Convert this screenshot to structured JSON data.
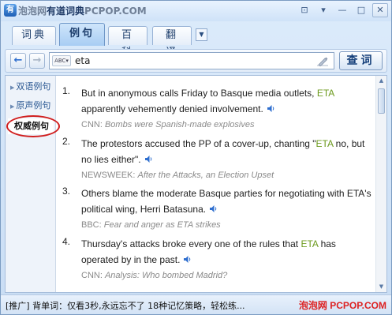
{
  "window": {
    "title": "有道词典",
    "watermark_prefix": "泡泡网",
    "watermark_suffix": "PCPOP.COM",
    "controls": [
      "⊡",
      "▾",
      "—",
      "□",
      "✕"
    ]
  },
  "tabs": [
    {
      "label": "词典",
      "active": false
    },
    {
      "label": "例句",
      "active": true
    },
    {
      "label": "百科",
      "active": false
    },
    {
      "label": "翻译",
      "active": false
    }
  ],
  "toolbar": {
    "search_value": "eta",
    "abc_label": "ABC",
    "query_label": "查词"
  },
  "sidebar": {
    "items": [
      {
        "label": "双语例句"
      },
      {
        "label": "原声例句"
      },
      {
        "label": "权威例句",
        "active": true
      }
    ]
  },
  "results": [
    {
      "num": "1.",
      "text_before": "But in anonymous calls Friday to Basque media outlets, ",
      "highlight": "ETA",
      "text_after": " apparently vehemently denied involvement.",
      "source": "CNN: ",
      "source_title": "Bombs were Spanish-made explosives"
    },
    {
      "num": "2.",
      "text_before": "The protestors accused the PP of a cover-up, chanting \"",
      "highlight": "ETA",
      "text_after": " no, but no lies either\".",
      "source": "NEWSWEEK: ",
      "source_title": "After the Attacks, an Election Upset"
    },
    {
      "num": "3.",
      "text_before": "Others blame the moderate Basque parties for negotiating with ETA's political wing, Herri Batasuna.",
      "highlight": "",
      "text_after": "",
      "source": "BBC: ",
      "source_title": "Fear and anger as ETA strikes"
    },
    {
      "num": "4.",
      "text_before": "Thursday's attacks broke every one of the rules that ",
      "highlight": "ETA",
      "text_after": " has operated by in the past.",
      "source": "CNN: ",
      "source_title": "Analysis: Who bombed Madrid?"
    }
  ],
  "statusbar": {
    "ad": "[推广] 背单词：仅看3秒,永远忘不了 18种记忆策略，轻松练...",
    "brand_prefix": "泡泡网",
    "brand_suffix": "PCPOP.COM"
  },
  "colors": {
    "highlight": "#6c9a1e",
    "ring": "#d01e1e",
    "chrome": "#cfe2f8"
  }
}
